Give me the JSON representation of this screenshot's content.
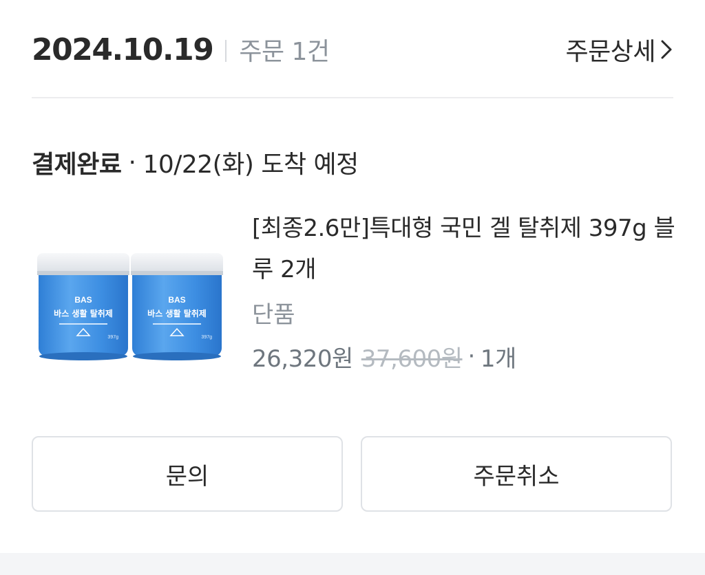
{
  "order": {
    "date": "2024.10.19",
    "count_label": "주문 1건",
    "detail_link_label": "주문상세"
  },
  "status": {
    "label": "결제완료",
    "separator": "·",
    "eta": "10/22(화) 도착 예정"
  },
  "product": {
    "name": "[최종2.6만]특대형 국민 겔 탈취제 397g 블루 2개",
    "option": "단품",
    "sale_price": "26,320원",
    "original_price": "37,600원",
    "separator": "·",
    "quantity": "1개",
    "image": {
      "brand": "BAS",
      "title": "바스 생활 탈취제",
      "weight": "397g"
    }
  },
  "buttons": {
    "inquiry": "문의",
    "cancel": "주문취소"
  },
  "colors": {
    "text_primary": "#2a2a2a",
    "text_secondary": "#8c939b",
    "text_strike": "#b4bac0",
    "border": "#dfe2e6",
    "gel_blue": "#3f8fe0"
  }
}
